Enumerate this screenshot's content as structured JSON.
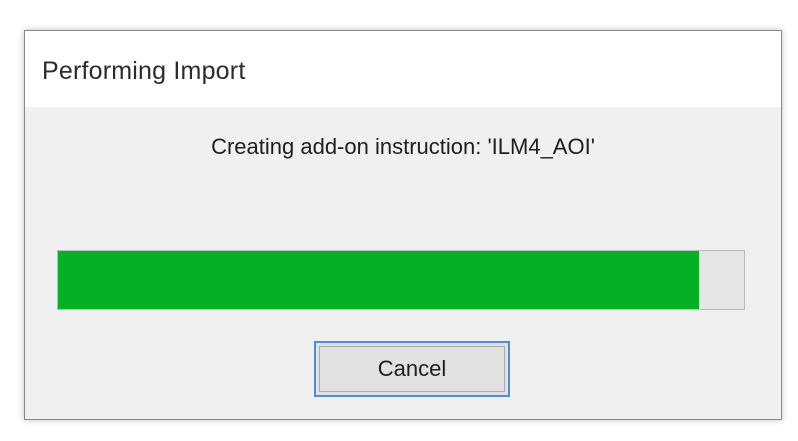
{
  "dialog": {
    "title": "Performing Import",
    "status_text": "Creating add-on instruction: 'ILM4_AOI'",
    "progress_fraction": 0.935,
    "progress_color": "#06b025",
    "cancel_label": "Cancel"
  }
}
